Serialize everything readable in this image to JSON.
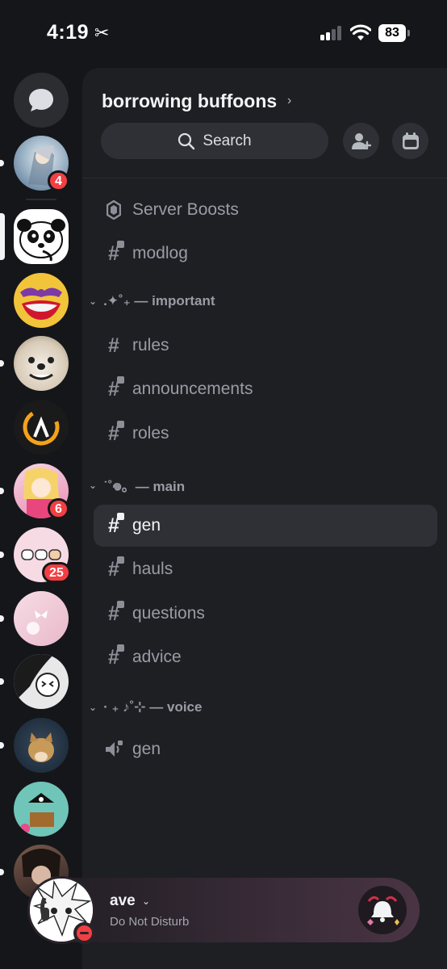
{
  "status_bar": {
    "time": "4:19",
    "battery": "83"
  },
  "server": {
    "name": "borrowing buffoons"
  },
  "search": {
    "label": "Search"
  },
  "channels": [
    {
      "type": "boost",
      "label": "Server Boosts"
    },
    {
      "type": "text-locked",
      "label": "modlog"
    }
  ],
  "categories": [
    {
      "label": ".✦˚₊ — important",
      "channels": [
        {
          "type": "text",
          "label": "rules"
        },
        {
          "type": "text-locked",
          "label": "announcements"
        },
        {
          "type": "text-locked",
          "label": "roles"
        }
      ]
    },
    {
      "label": "˙˚𖦹。— main",
      "channels": [
        {
          "type": "text-locked",
          "label": "gen",
          "active": true
        },
        {
          "type": "text-locked",
          "label": "hauls"
        },
        {
          "type": "text-locked",
          "label": "questions"
        },
        {
          "type": "text-locked",
          "label": "advice"
        }
      ]
    },
    {
      "label": "· ₊ ♪˚⊹ — voice",
      "channels": [
        {
          "type": "voice",
          "label": "gen"
        }
      ]
    }
  ],
  "servers": [
    {
      "name": "server-1",
      "badge": "4",
      "unread": true
    },
    {
      "name": "server-2",
      "selected": true
    },
    {
      "name": "server-3"
    },
    {
      "name": "server-4",
      "unread": true
    },
    {
      "name": "server-5"
    },
    {
      "name": "server-6",
      "badge": "6",
      "unread": true
    },
    {
      "name": "server-7",
      "badge": "25",
      "unread": true
    },
    {
      "name": "server-8",
      "unread": true
    },
    {
      "name": "server-9",
      "unread": true
    },
    {
      "name": "server-10",
      "unread": true
    },
    {
      "name": "server-11"
    },
    {
      "name": "server-12",
      "unread": true
    }
  ],
  "user": {
    "name": "ave",
    "status": "Do Not Disturb"
  },
  "colors": {
    "dnd": "#f23f43",
    "badge": "#f23f43",
    "panel": "#1e1f23",
    "rail": "#151619"
  }
}
